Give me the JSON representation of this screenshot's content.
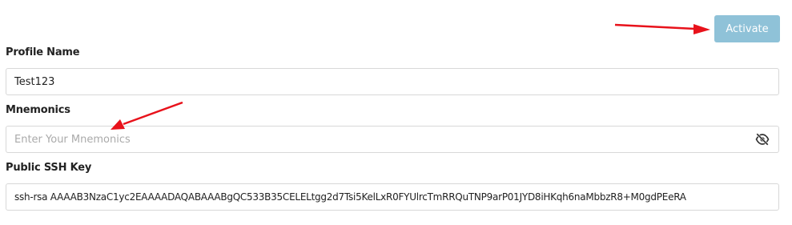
{
  "toolbar": {
    "activate_label": "Activate"
  },
  "form": {
    "profile_name": {
      "label": "Profile Name",
      "value": "Test123"
    },
    "mnemonics": {
      "label": "Mnemonics",
      "placeholder": "Enter Your Mnemonics",
      "value": "",
      "toggle_icon": "eye-slash-icon"
    },
    "ssh_key": {
      "label": "Public SSH Key",
      "value": "ssh-rsa AAAAB3NzaC1yc2EAAAADAQABAAABgQC533B35CELELtgg2d7Tsi5KelLxR0FYUlrcTmRRQuTNP9arP01JYD8iHKqh6naMbbzR8+M0gdPEeRA"
    }
  },
  "colors": {
    "button_bg": "#8fc2d8",
    "annotation_arrow": "#e8121b"
  }
}
